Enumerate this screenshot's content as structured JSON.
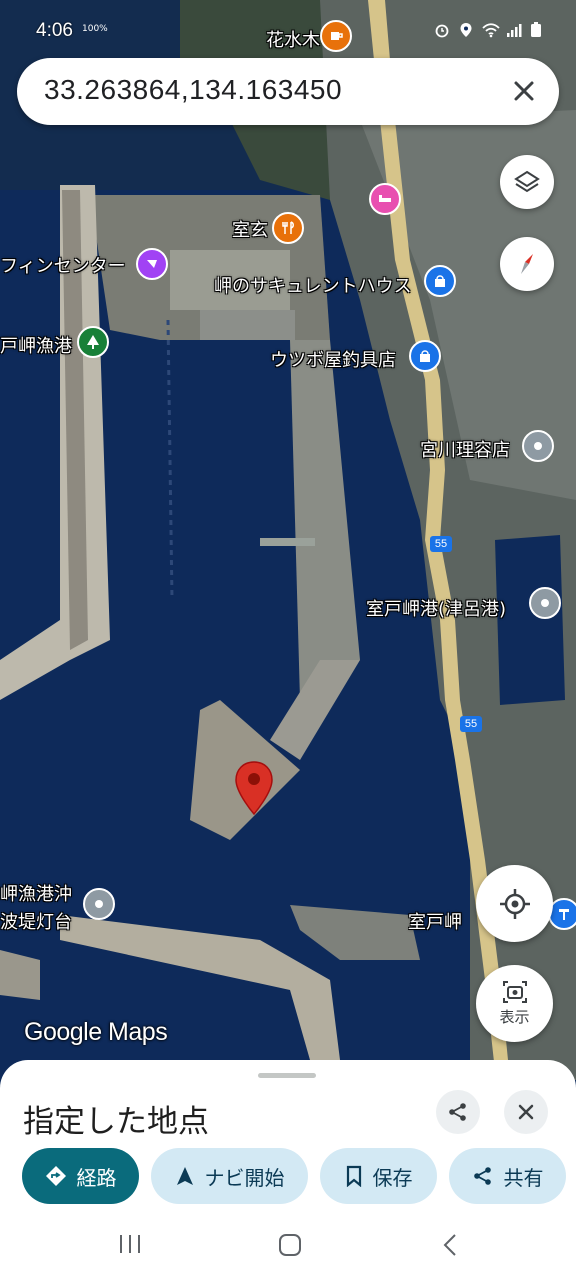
{
  "status_bar": {
    "time": "4:06",
    "battery_small": "100%"
  },
  "search": {
    "query": "33.263864,134.163450"
  },
  "map": {
    "labels": {
      "hanamizuki": "花水木",
      "murogen": "室玄",
      "dolphin_center": "フィンセンター",
      "succulent_house": "岬のサキュレントハウス",
      "fishing_port": "戸岬漁港",
      "utsubo": "ウツボ屋釣具店",
      "miyagawa": "宮川理容店",
      "tsuro_port": "室戸岬港(津呂港)",
      "lighthouse_line1": "岬漁港沖",
      "lighthouse_line2": "波堤灯台",
      "muroto_cape": "室戸岬"
    },
    "route_numbers": [
      "55",
      "55"
    ],
    "watermark": "Google Maps"
  },
  "controls": {
    "view_label": "表示"
  },
  "sheet": {
    "title": "指定した地点",
    "chips": [
      {
        "label": "経路",
        "icon": "directions-icon"
      },
      {
        "label": "ナビ開始",
        "icon": "navigation-arrow-icon"
      },
      {
        "label": "保存",
        "icon": "bookmark-icon"
      },
      {
        "label": "共有",
        "icon": "share-icon"
      }
    ]
  },
  "colors": {
    "pin": "#d93025",
    "primary_chip": "#0a6b7c",
    "secondary_chip": "#d3e9f4",
    "water": "#0d2b5c"
  }
}
